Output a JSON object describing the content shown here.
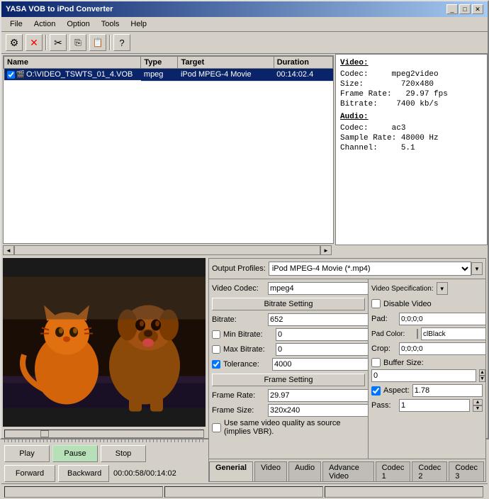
{
  "window": {
    "title": "YASA VOB to iPod Converter"
  },
  "menu": {
    "items": [
      "File",
      "Action",
      "Option",
      "Tools",
      "Help"
    ]
  },
  "toolbar": {
    "icons": [
      "settings-icon",
      "close-icon",
      "cut-icon",
      "copy-icon",
      "paste-icon",
      "help-icon"
    ]
  },
  "file_list": {
    "columns": [
      "Name",
      "Type",
      "Target",
      "Duration"
    ],
    "rows": [
      {
        "name": "O:\\VIDEO_TSWTS_01_4.VOB",
        "type": "mpeg",
        "target": "iPod MPEG-4 Movie",
        "duration": "00:14:02.4",
        "selected": true
      }
    ]
  },
  "info_panel": {
    "video_title": "Video:",
    "video_codec_label": "Codec:",
    "video_codec_value": "mpeg2video",
    "video_size_label": "Size:",
    "video_size_value": "720x480",
    "video_framerate_label": "Frame Rate:",
    "video_framerate_value": "29.97 fps",
    "video_bitrate_label": "Bitrate:",
    "video_bitrate_value": "7400 kb/s",
    "audio_title": "Audio:",
    "audio_codec_label": "Codec:",
    "audio_codec_value": "ac3",
    "audio_samplerate_label": "Sample Rate:",
    "audio_samplerate_value": "48000 Hz",
    "audio_channel_label": "Channel:",
    "audio_channel_value": "5.1"
  },
  "settings": {
    "output_profiles_label": "Output Profiles:",
    "output_profile_value": "iPod MPEG-4 Movie (*.mp4)",
    "video_codec_label": "Video Codec:",
    "video_codec_value": "mpeg4",
    "video_spec_label": "Video Specification:",
    "bitrate_section": "Bitrate Setting",
    "bitrate_label": "Bitrate:",
    "bitrate_value": "652",
    "min_bitrate_label": "Min Bitrate:",
    "min_bitrate_value": "0",
    "max_bitrate_label": "Max Bitrate:",
    "max_bitrate_value": "0",
    "tolerance_label": "Tolerance:",
    "tolerance_value": "4000",
    "frame_section": "Frame Setting",
    "frame_rate_label": "Frame Rate:",
    "frame_rate_value": "29.97",
    "frame_size_label": "Frame Size:",
    "frame_size_value": "320x240",
    "vbr_checkbox": "Use same video quality as source (implies VBR).",
    "disable_video_label": "Disable Video",
    "pad_label": "Pad:",
    "pad_value": "0;0;0;0",
    "pad_color_label": "Pad Color:",
    "pad_color_value": "clBlack",
    "crop_label": "Crop:",
    "crop_value": "0;0;0;0",
    "buffer_size_label": "Buffer Size:",
    "buffer_size_value": "0",
    "aspect_label": "Aspect:",
    "aspect_value": "1.78",
    "pass_label": "Pass:",
    "pass_value": "1"
  },
  "tabs": {
    "items": [
      "Generial",
      "Video",
      "Audio",
      "Advance Video",
      "Codec 1",
      "Codec 2",
      "Codec 3"
    ],
    "active": "Generial"
  },
  "player": {
    "play_label": "Play",
    "pause_label": "Pause",
    "stop_label": "Stop",
    "forward_label": "Forward",
    "backward_label": "Backward",
    "time_current": "00:00:58",
    "time_total": "00:14:02"
  },
  "status_bar": {
    "text": ""
  }
}
